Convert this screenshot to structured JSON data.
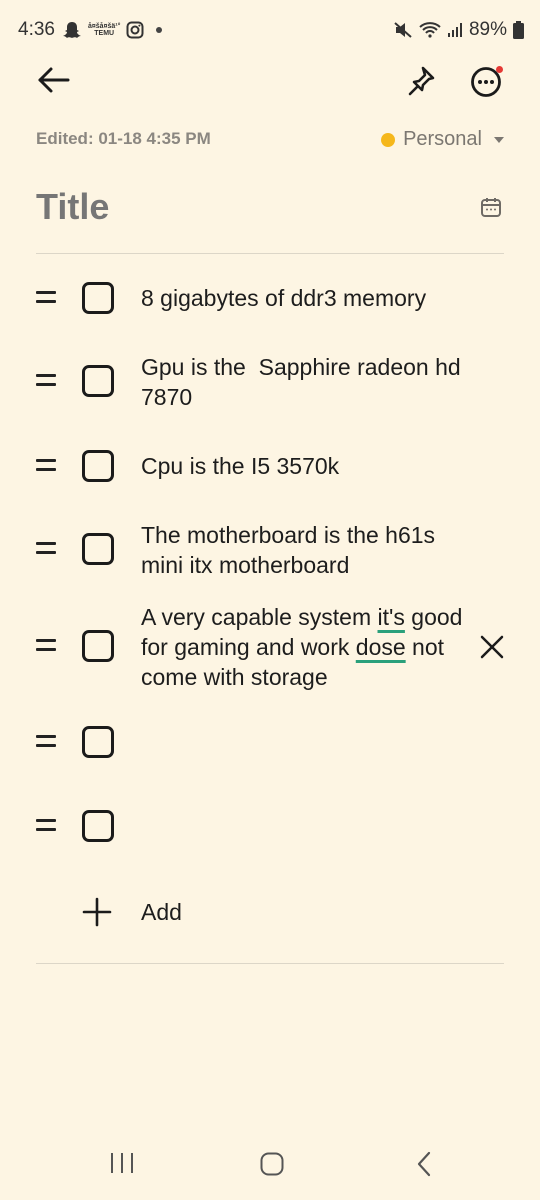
{
  "status_bar": {
    "time": "4:36",
    "battery": "89%",
    "temu_line1": "å¤šå¤šä¹°",
    "temu_line2": "TEMU"
  },
  "toolbar": {
    "back": "back-arrow-icon",
    "pin": "pin-icon",
    "more": "more-options-icon"
  },
  "note": {
    "edited": "Edited: 01-18 4:35 PM",
    "category": "Personal",
    "category_color": "#f5b71b",
    "title_placeholder": "Title"
  },
  "checklist": {
    "items": [
      {
        "text": "8 gigabytes of ddr3 memory",
        "checked": false
      },
      {
        "text": "Gpu is the  Sapphire radeon hd 7870",
        "checked": false
      },
      {
        "text": "Cpu is the I5 3570k",
        "checked": false
      },
      {
        "text": "The motherboard is the h61s mini itx motherboard",
        "checked": false
      },
      {
        "text_part1": "A very capable system ",
        "text_spell1": "it's",
        "text_part2": " good for gaming and work ",
        "text_spell2": "dose",
        "text_part3": " not come with storage",
        "checked": false
      },
      {
        "text": "",
        "checked": false
      },
      {
        "text": "",
        "checked": false
      }
    ],
    "add_label": "Add"
  },
  "colors": {
    "background": "#fdf5e3",
    "spell_underline": "#2aa07b",
    "notification_dot": "#e53935"
  }
}
